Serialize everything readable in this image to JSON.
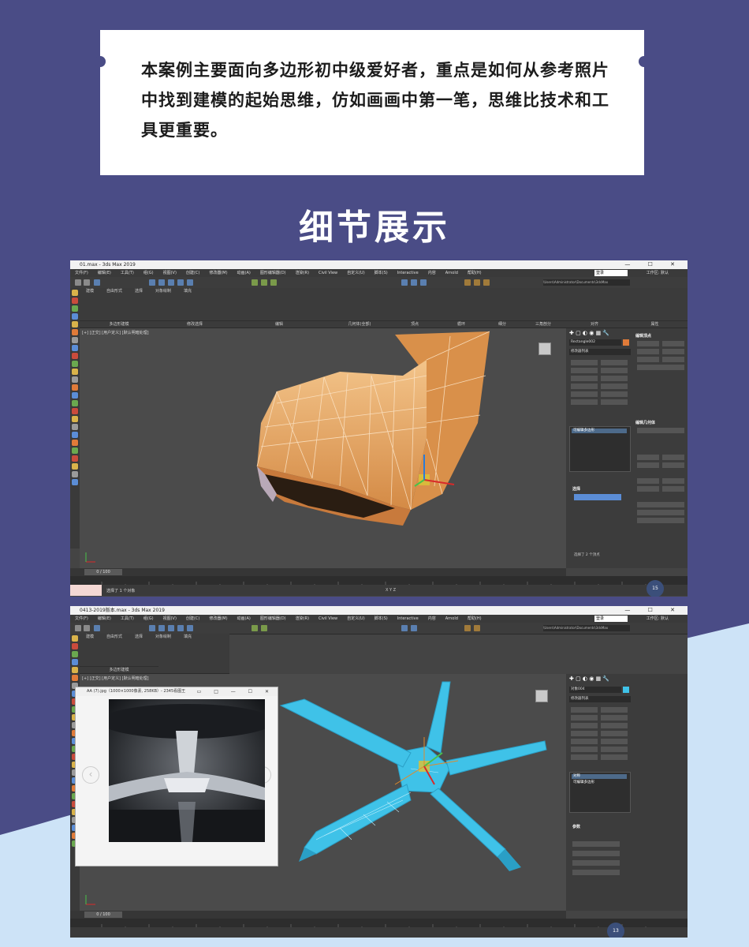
{
  "intro": {
    "text": "本案例主要面向多边形初中级爱好者，重点是如何从参考照片中找到建模的起始思维，仿如画画中第一笔，思维比技术和工具更重要。"
  },
  "section_title": "细节展示",
  "colors": {
    "page_bg": "#4a4c86",
    "wave": "#cde3f7",
    "model_orange": "#e9a866",
    "model_cyan": "#3fc2e8",
    "viewport_bg": "#4b4b4b"
  },
  "screenshot1": {
    "window_title": "01.max - 3ds Max 2019",
    "menu": [
      "文件(F)",
      "编辑(E)",
      "工具(T)",
      "组(G)",
      "视图(V)",
      "创建(C)",
      "修改器(M)",
      "动画(A)",
      "图形编辑器(D)",
      "渲染(R)",
      "Civil View",
      "自定义(U)",
      "脚本(S)",
      "Interactive",
      "内容",
      "Arnold",
      "帮助(H)"
    ],
    "search_box": "登录",
    "workspace": "工作区: 默认",
    "path": "\\Users\\Administrator\\Documents\\3dsMax",
    "ribbon_tabs": [
      "建模",
      "自由形式",
      "选择",
      "对象绘制",
      "填充"
    ],
    "ribbon_groups": [
      "多边形建模",
      "修改选择",
      "编辑",
      "几何体(全部)",
      "顶点",
      "循环",
      "细分",
      "三角剖分",
      "对齐",
      "属性"
    ],
    "viewport_label": "[+] [正交] [用户定义] [默认明暗处理]",
    "object_name": "Rectangle002",
    "modifier_list": "修改器列表",
    "stack": [
      "可编辑多边形"
    ],
    "panel_sections": [
      "编辑顶点",
      "选择",
      "编辑几何体"
    ],
    "selection_text": "选择了 2 个顶点",
    "status_text": "选择了 1 个对象",
    "timeline": "0 / 100",
    "frame_badge": "15"
  },
  "screenshot2": {
    "window_title": "0413-2019版本.max - 3ds Max 2019",
    "menu": [
      "文件(F)",
      "编辑(E)",
      "工具(T)",
      "组(G)",
      "视图(V)",
      "创建(C)",
      "修改器(M)",
      "动画(A)",
      "图形编辑器(D)",
      "渲染(R)",
      "Civil View",
      "自定义(U)",
      "脚本(S)",
      "Interactive",
      "内容",
      "Arnold",
      "帮助(H)"
    ],
    "search_box": "登录",
    "workspace": "工作区: 默认",
    "ribbon_tabs": [
      "建模",
      "自由形式",
      "选择",
      "对象绘制",
      "填充"
    ],
    "ribbon_groups": [
      "多边形建模"
    ],
    "viewport_label": "[+] [正交] [用户定义] [默认明暗处理]",
    "image_viewer_title": "AA (7).jpg（1000×1000像素, 258KB）- 2345看图王",
    "object_name": "对象004",
    "modifier_list": "修改器列表",
    "stack": [
      "对称",
      "可编辑多边形"
    ],
    "panel_sections": [
      "参数"
    ],
    "timeline": "0 / 100",
    "frame_badge": "13"
  }
}
